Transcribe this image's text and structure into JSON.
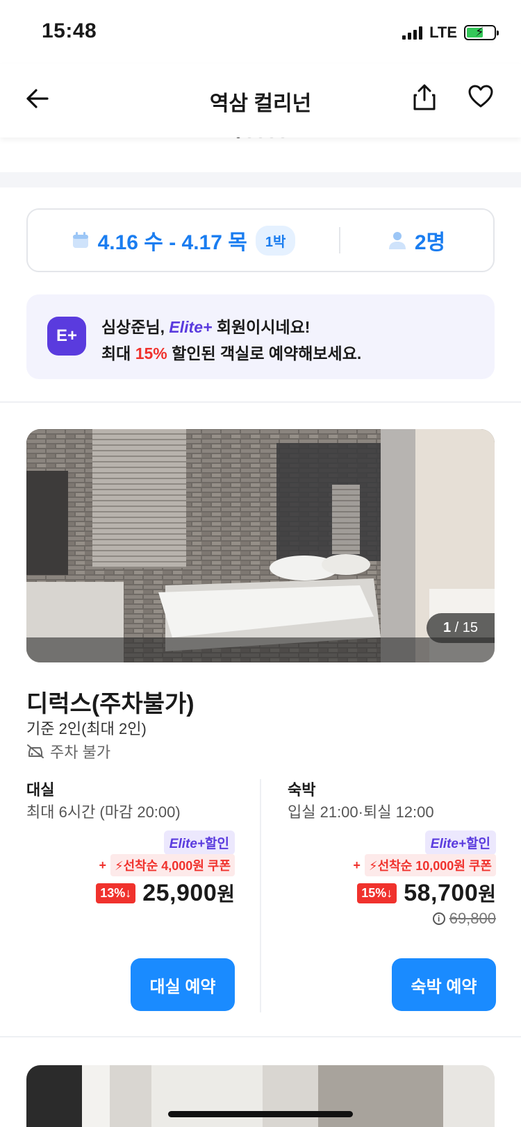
{
  "status_bar": {
    "time": "15:48",
    "network": "LTE"
  },
  "header": {
    "title": "역삼 컬리넌"
  },
  "carousel": {
    "dots": 5,
    "active_index": 0
  },
  "booking": {
    "dates": "4.16 수 - 4.17 목",
    "nights": "1박",
    "guests": "2명"
  },
  "elite_banner": {
    "line1_prefix": "심상준님, ",
    "brand": "Elite+",
    "line1_suffix": " 회원이시네요!",
    "line2_prefix": "최대 ",
    "percent": "15%",
    "line2_suffix": " 할인된 객실로 예약해보세요.",
    "logo_text": "E+"
  },
  "room": {
    "image_counter_current": "1",
    "image_counter_total": "/ 15",
    "name": "디럭스(주차불가)",
    "capacity": "기준 2인(최대 2인)",
    "parking": "주차 불가"
  },
  "day_use": {
    "title": "대실",
    "subtitle": "최대 6시간 (마감 20:00)",
    "elite_brand": "Elite+",
    "elite_text": "할인",
    "coupon_plus": "+",
    "coupon": "선착순 4,000원 쿠폰",
    "discount": "13%↓",
    "price": "25,900",
    "unit": "원",
    "button": "대실 예약"
  },
  "overnight": {
    "title": "숙박",
    "subtitle": "입실 21:00·퇴실 12:00",
    "elite_brand": "Elite+",
    "elite_text": "할인",
    "coupon_plus": "+",
    "coupon": "선착순 10,000원 쿠폰",
    "discount": "15%↓",
    "price": "58,700",
    "unit": "원",
    "original_price": "69,800",
    "button": "숙박 예약"
  },
  "colors": {
    "accent": "#1a8bff",
    "elite": "#5a3bde",
    "discount": "#f0322d"
  }
}
